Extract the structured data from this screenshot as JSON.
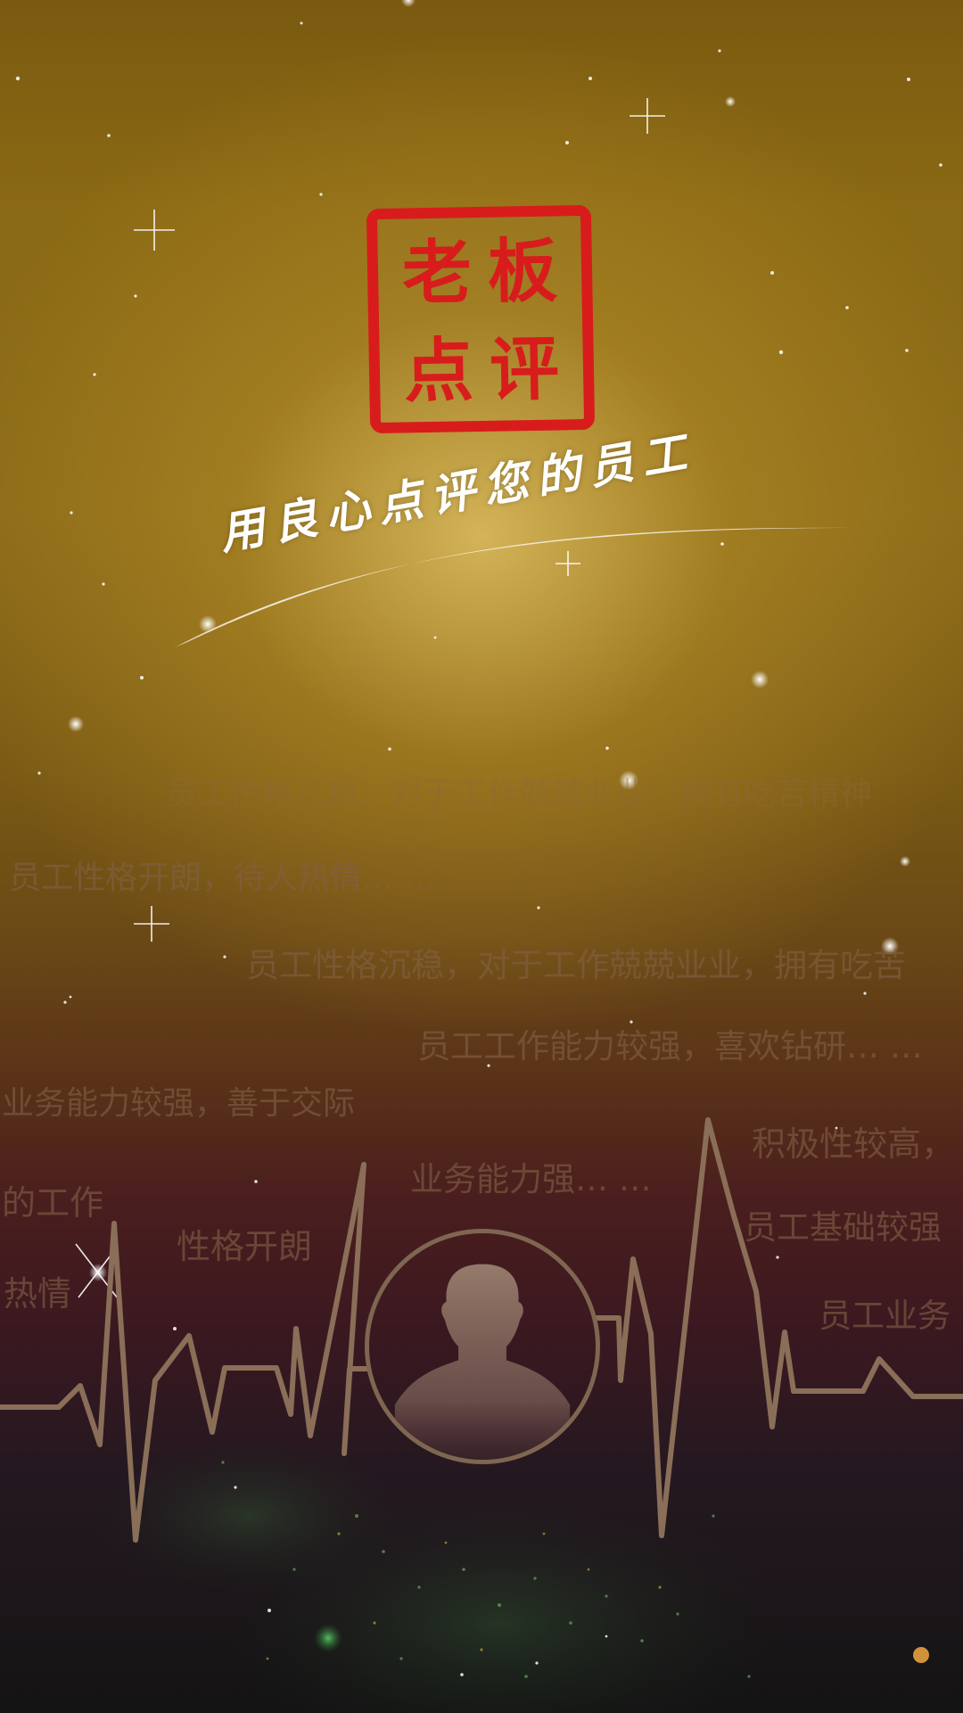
{
  "logo": {
    "chars": [
      "老",
      "板",
      "点",
      "评"
    ],
    "color": "#d81c1c"
  },
  "slogan": "用良心点评您的员工",
  "phrases": [
    "员工性格沉稳，对于工作兢兢业业，拥有吃苦精神",
    "员工性格开朗，待人热情… …",
    "员工性格沉稳，对于工作兢兢业业，拥有吃苦",
    "员工工作能力较强，喜欢钻研… …",
    "业务能力较强，善于交际",
    "积极性较高，",
    "业务能力强… …",
    "的工作",
    "员工基础较强",
    "性格开朗",
    "热情",
    "员工业务"
  ],
  "avatar": {
    "icon": "person-silhouette-icon"
  },
  "colors": {
    "accent": "#d81c1c",
    "ekg_line": "#8a6e58",
    "phrase_text": "#826046"
  }
}
